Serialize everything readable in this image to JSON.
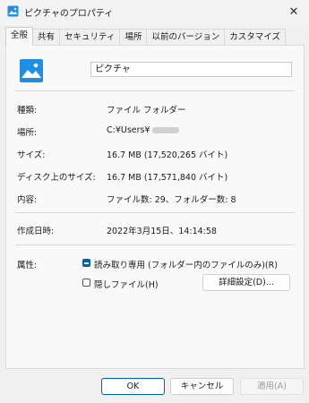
{
  "window": {
    "title": "ピクチャのプロパティ",
    "close_glyph": "✕"
  },
  "tabs": [
    {
      "label": "全般",
      "active": true
    },
    {
      "label": "共有"
    },
    {
      "label": "セキュリティ"
    },
    {
      "label": "場所"
    },
    {
      "label": "以前のバージョン"
    },
    {
      "label": "カスタマイズ"
    }
  ],
  "general": {
    "name": "ピクチャ",
    "rows": [
      {
        "label": "種類:",
        "value": "ファイル フォルダー"
      },
      {
        "label": "場所:",
        "value": "C:¥Users¥"
      },
      {
        "label": "サイズ:",
        "value": "16.7 MB (17,520,265 バイト)"
      },
      {
        "label": "ディスク上のサイズ:",
        "value": "16.7 MB (17,571,840 バイト)"
      },
      {
        "label": "内容:",
        "value": "ファイル数: 29、フォルダー数: 8"
      }
    ],
    "created_label": "作成日時:",
    "created_value": "2022年3月15日、14:14:58",
    "attributes_label": "属性:",
    "readonly_label": "読み取り専用 (フォルダー内のファイルのみ)(R)",
    "readonly_state": "indeterminate",
    "hidden_label": "隠しファイル(H)",
    "hidden_checked": false,
    "advanced_button": "詳細設定(D)..."
  },
  "footer": {
    "ok": "OK",
    "cancel": "キャンセル",
    "apply": "適用(A)"
  },
  "colors": {
    "accent": "#005fb8",
    "icon_blue": "#1f8ee6"
  }
}
